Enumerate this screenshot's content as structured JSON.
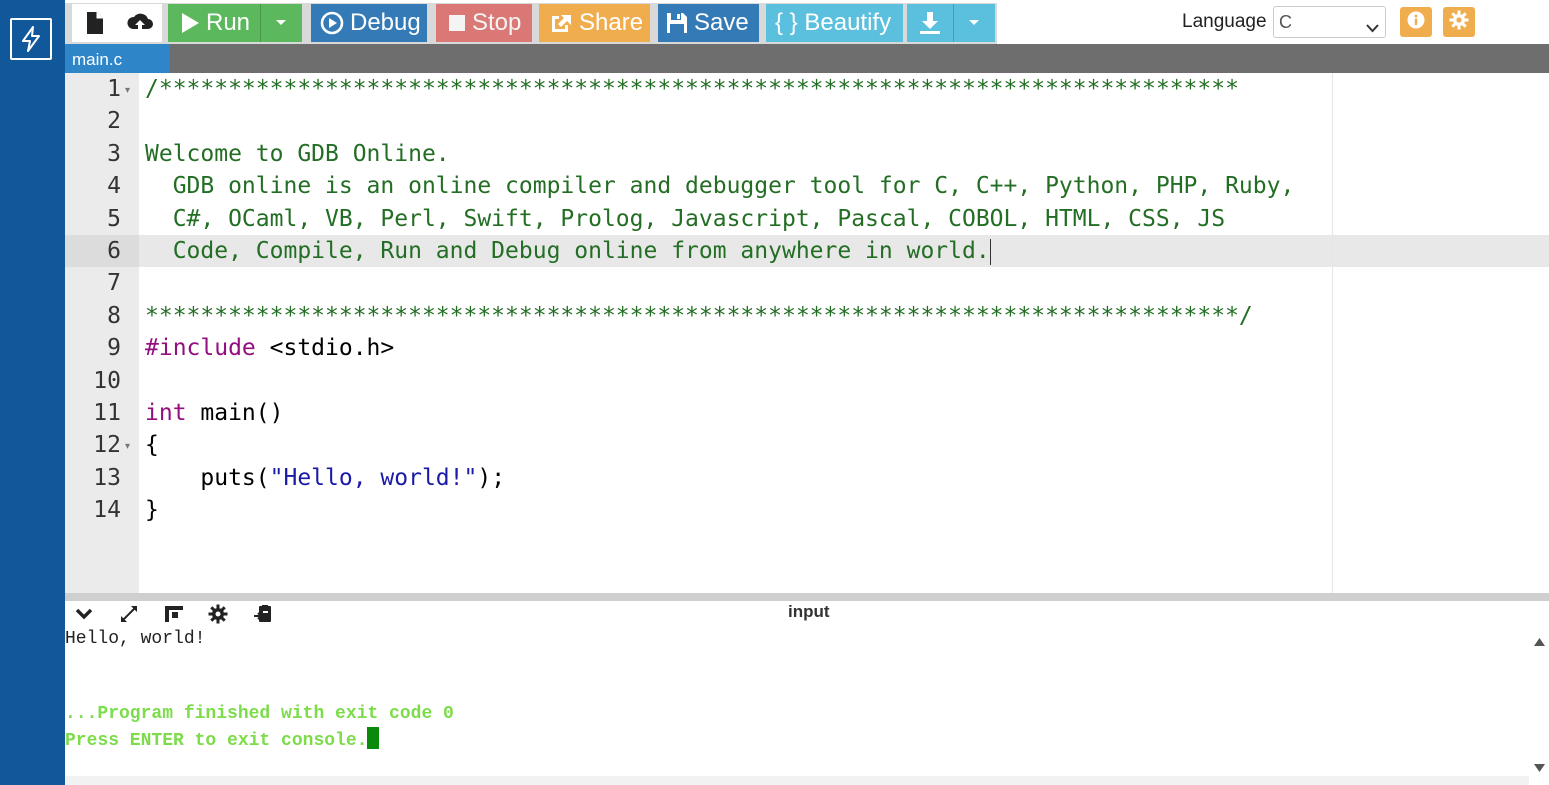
{
  "toolbar": {
    "run_label": "Run",
    "debug_label": "Debug",
    "stop_label": "Stop",
    "share_label": "Share",
    "save_label": "Save",
    "beautify_label": "{ } Beautify",
    "language_label": "Language",
    "language_value": "C"
  },
  "colors": {
    "rail": "#10589a",
    "run": "#5cb85c",
    "debug": "#337ab7",
    "stop": "#d9534f",
    "share": "#f0ad4e",
    "beautify": "#5bc0de",
    "comment": "#236e24",
    "keyword": "#930f80",
    "string": "#1a1aa6",
    "console_green": "#7cdc4a"
  },
  "tabs": [
    {
      "label": "main.c"
    }
  ],
  "editor": {
    "line_numbers": [
      "1",
      "2",
      "3",
      "4",
      "5",
      "6",
      "7",
      "8",
      "9",
      "10",
      "11",
      "12",
      "13",
      "14"
    ],
    "lines": {
      "l1": "/******************************************************************************",
      "l2": "",
      "l3": "Welcome to GDB Online.",
      "l4": "  GDB online is an online compiler and debugger tool for C, C++, Python, PHP, Ruby,",
      "l5": "  C#, OCaml, VB, Perl, Swift, Prolog, Javascript, Pascal, COBOL, HTML, CSS, JS",
      "l6": "  Code, Compile, Run and Debug online from anywhere in world.",
      "l7": "",
      "l8": "*******************************************************************************/",
      "l9_kw": "#include",
      "l9_rest": " <stdio.h>",
      "l11_kw": "int",
      "l11_rest": " main()",
      "l12": "{",
      "l13_pre": "    puts(",
      "l13_str": "\"Hello, world!\"",
      "l13_post": ");",
      "l14": "}"
    }
  },
  "console": {
    "input_label": "input",
    "output_line1": "Hello, world!",
    "finished": "...Program finished with exit code 0",
    "press_enter": "Press ENTER to exit console."
  },
  "icons": [
    "bolt-icon",
    "new-file-icon",
    "upload-icon",
    "play-icon",
    "caret-down-icon",
    "debug-circle-icon",
    "stop-square-icon",
    "share-icon",
    "floppy-icon",
    "download-icon",
    "info-icon",
    "gear-icon",
    "chevron-down-icon",
    "expand-icon",
    "layout-icon",
    "settings-icon",
    "clear-console-icon",
    "scroll-up-icon",
    "scroll-down-icon"
  ]
}
